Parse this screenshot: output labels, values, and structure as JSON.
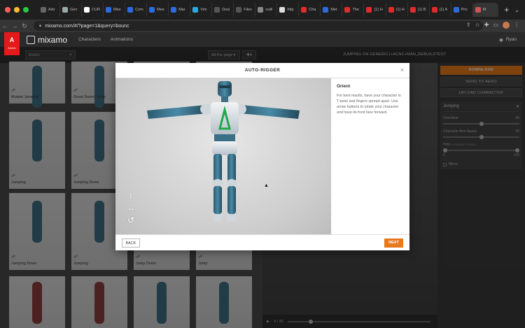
{
  "browser": {
    "tabs": [
      {
        "label": "Adv",
        "color": "#666"
      },
      {
        "label": "Gen",
        "color": "#9aa"
      },
      {
        "label": "CUR",
        "color": "#fff"
      },
      {
        "label": "Mee",
        "color": "#2b6be0"
      },
      {
        "label": "Com",
        "color": "#2b6be0"
      },
      {
        "label": "Mee",
        "color": "#2b6be0"
      },
      {
        "label": "Mai",
        "color": "#2b6be0"
      },
      {
        "label": "Vim",
        "color": "#2ba9e0"
      },
      {
        "label": "Desi",
        "color": "#555"
      },
      {
        "label": "Files",
        "color": "#555"
      },
      {
        "label": "outli",
        "color": "#888"
      },
      {
        "label": "http",
        "color": "#ddd"
      },
      {
        "label": "Cha",
        "color": "#e02b2b"
      },
      {
        "label": "Met",
        "color": "#2b6be0"
      },
      {
        "label": "The",
        "color": "#e02b2b"
      },
      {
        "label": "(1) H",
        "color": "#e02b2b"
      },
      {
        "label": "(1) H",
        "color": "#e02b2b"
      },
      {
        "label": "(1) B",
        "color": "#e02b2b"
      },
      {
        "label": "(1) A",
        "color": "#e02b2b"
      },
      {
        "label": "Pric",
        "color": "#2b6be0"
      },
      {
        "label": "M",
        "color": "#c55"
      }
    ],
    "new_tab": "+",
    "url": "mixamo.com/#/?page=1&query=bounc"
  },
  "app": {
    "logo": "mixamo",
    "adobe": "A",
    "adobe_sub": "Adobe",
    "nav": [
      "Characters",
      "Animations"
    ],
    "user": "Ryan"
  },
  "toolbar": {
    "search_value": "bounc",
    "per_page": "All Per page",
    "character_title": "JUMPING ON GENERIC1+ACNC+MAN_REBUILDTEST"
  },
  "gallery": {
    "cards": [
      {
        "label": "Mutant Jumping"
      },
      {
        "label": "Great Sword Jump"
      },
      {
        "label": ""
      },
      {
        "label": ""
      },
      {
        "label": "Jumping"
      },
      {
        "label": "Jumping Down"
      },
      {
        "label": ""
      },
      {
        "label": ""
      },
      {
        "label": "Jumping Down"
      },
      {
        "label": "Jumping"
      },
      {
        "label": "Jump Down"
      },
      {
        "label": "Jump"
      }
    ]
  },
  "right_panel": {
    "download": "DOWNLOAD",
    "send_to_aero": "SEND TO AERO",
    "upload_character": "UPLOAD CHARACTER",
    "animation_name": "Jumping",
    "sliders": [
      {
        "label": "Overdrive",
        "value": "50"
      },
      {
        "label": "Character Arm-Space",
        "value": "50"
      }
    ],
    "trim_label": "Trim",
    "trim_sub": "Animation Frames",
    "trim_min": "0",
    "trim_max": "100",
    "mirror": "Mirror",
    "frame": "9 / 43"
  },
  "modal": {
    "title": "AUTO-RIGGER",
    "section_title": "Orient",
    "instructions": "For best results, have your character in T-pose and fingers spread apart. Use arrow buttons to rotate your character and have its front face forward.",
    "back": "BACK",
    "next": "NEXT",
    "accent": "#e6781d"
  }
}
